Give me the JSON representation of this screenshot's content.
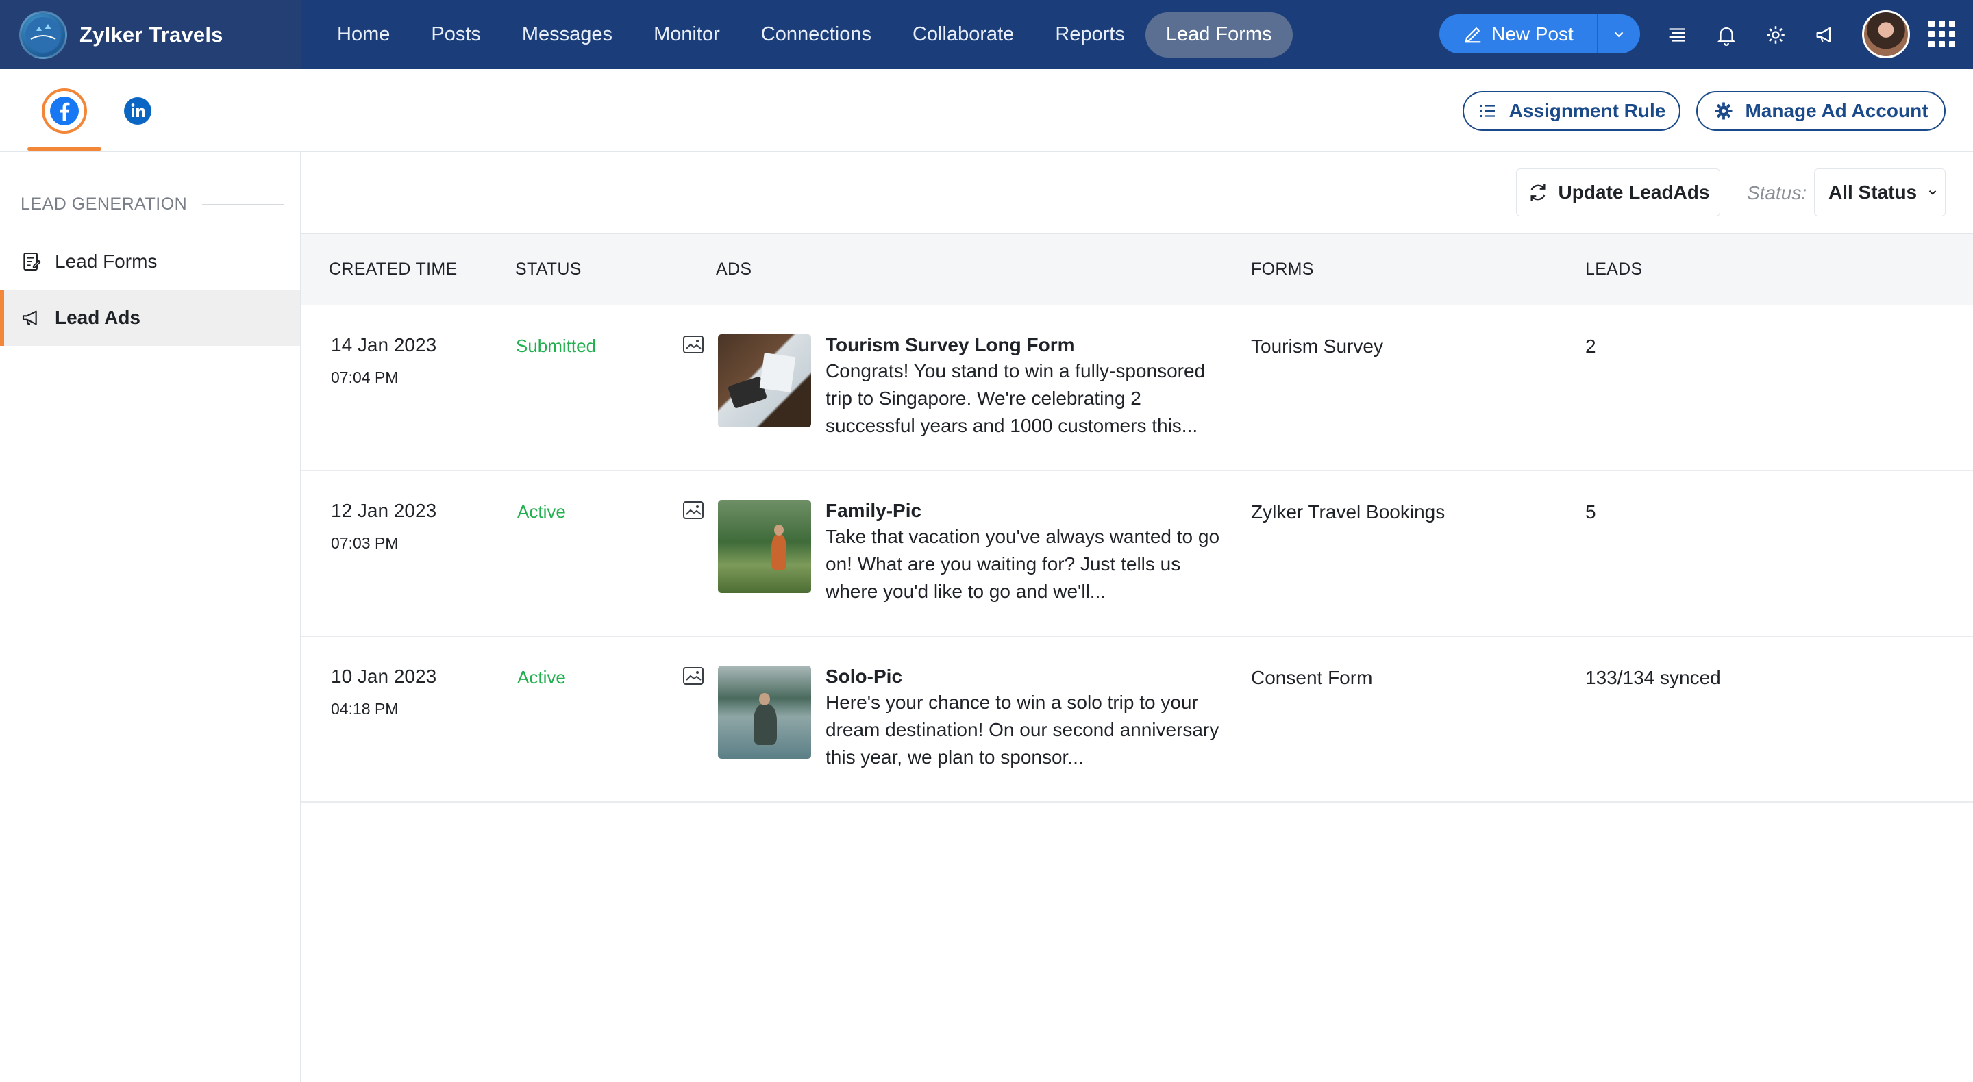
{
  "brand": {
    "name": "Zylker Travels",
    "logo_text": "Zylker Travels"
  },
  "nav": {
    "items": [
      {
        "label": "Home"
      },
      {
        "label": "Posts"
      },
      {
        "label": "Messages"
      },
      {
        "label": "Monitor"
      },
      {
        "label": "Connections"
      },
      {
        "label": "Collaborate"
      },
      {
        "label": "Reports"
      },
      {
        "label": "Lead Forms",
        "active": true
      }
    ]
  },
  "toolbar": {
    "new_post_label": "New Post"
  },
  "top_icons": [
    "menu-icon",
    "bell-icon",
    "gear-icon",
    "megaphone-icon"
  ],
  "subheader": {
    "networks": [
      "facebook",
      "linkedin"
    ],
    "assignment_rule_label": "Assignment Rule",
    "manage_ad_account_label": "Manage Ad Account"
  },
  "sidebar": {
    "heading": "LEAD GENERATION",
    "items": [
      {
        "label": "Lead Forms",
        "icon": "form-icon"
      },
      {
        "label": "Lead Ads",
        "icon": "megaphone-icon",
        "active": true
      }
    ]
  },
  "filters": {
    "update_label": "Update LeadAds",
    "status_label": "Status:",
    "status_value": "All Status"
  },
  "table": {
    "columns": [
      "CREATED TIME",
      "STATUS",
      "ADS",
      "FORMS",
      "LEADS"
    ],
    "rows": [
      {
        "date": "14 Jan 2023",
        "time": "07:04 PM",
        "status": "Submitted",
        "ad_title": "Tourism Survey Long Form",
        "ad_desc": "Congrats! You stand to win a fully-sponsored trip to Singapore. We're celebrating 2 successful years and 1000 customers this...",
        "form": "Tourism Survey",
        "leads": "2"
      },
      {
        "date": "12 Jan 2023",
        "time": "07:03 PM",
        "status": "Active",
        "ad_title": "Family-Pic",
        "ad_desc": "Take that vacation you've always wanted to go on! What are you waiting for? Just tells us where you'd like to go and we'll...",
        "form": "Zylker Travel Bookings",
        "leads": "5"
      },
      {
        "date": "10 Jan 2023",
        "time": "04:18 PM",
        "status": "Active",
        "ad_title": "Solo-Pic",
        "ad_desc": "Here's your chance to win a solo trip to your dream destination! On our second anniversary this year, we plan to sponsor...",
        "form": "Consent Form",
        "leads": "133/134 synced"
      }
    ]
  },
  "colors": {
    "nav_bg": "#1b3e7a",
    "accent_orange": "#f2873a",
    "primary_blue": "#2f7fea",
    "status_green": "#22b04f"
  }
}
